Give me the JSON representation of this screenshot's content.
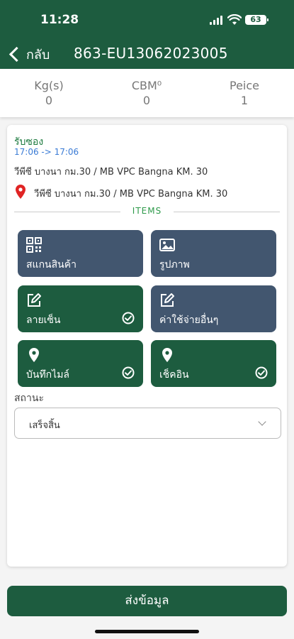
{
  "status_bar": {
    "time": "11:28",
    "battery": "63"
  },
  "nav": {
    "back_label": "กลับ",
    "title": "863-EU13062023005"
  },
  "stats": [
    {
      "label": "Kg(s)",
      "value": "0"
    },
    {
      "label": "CBM⁰",
      "value": "0"
    },
    {
      "label": "Peice",
      "value": "1"
    }
  ],
  "job": {
    "type": "รับซอง",
    "time_range": "17:06 -> 17:06",
    "origin": "วีพีซี บางนา กม.30 / MB VPC Bangna KM. 30",
    "destination": "วีพีซี บางนา กม.30 / MB VPC Bangna KM. 30"
  },
  "items_label": "ITEMS",
  "actions": [
    {
      "label": "สแกนสินค้า",
      "icon": "qr-code-icon",
      "done": false
    },
    {
      "label": "รูปภาพ",
      "icon": "image-icon",
      "done": false
    },
    {
      "label": "ลายเซ็น",
      "icon": "edit-icon",
      "done": true
    },
    {
      "label": "ค่าใช้จ่ายอื่นๆ",
      "icon": "edit-icon",
      "done": false
    },
    {
      "label": "บันทึกไมล์",
      "icon": "location-pin-icon",
      "done": true
    },
    {
      "label": "เช็คอิน",
      "icon": "location-pin-icon",
      "done": true
    }
  ],
  "status_field": {
    "label": "สถานะ",
    "value": "เสร็จสิ้น"
  },
  "submit_label": "ส่งข้อมูล",
  "colors": {
    "primary": "#1d5c3f",
    "secondary": "#42566f",
    "accent_text": "#1d7a3f",
    "time_text": "#3a7bd5",
    "pin": "#e02424"
  }
}
